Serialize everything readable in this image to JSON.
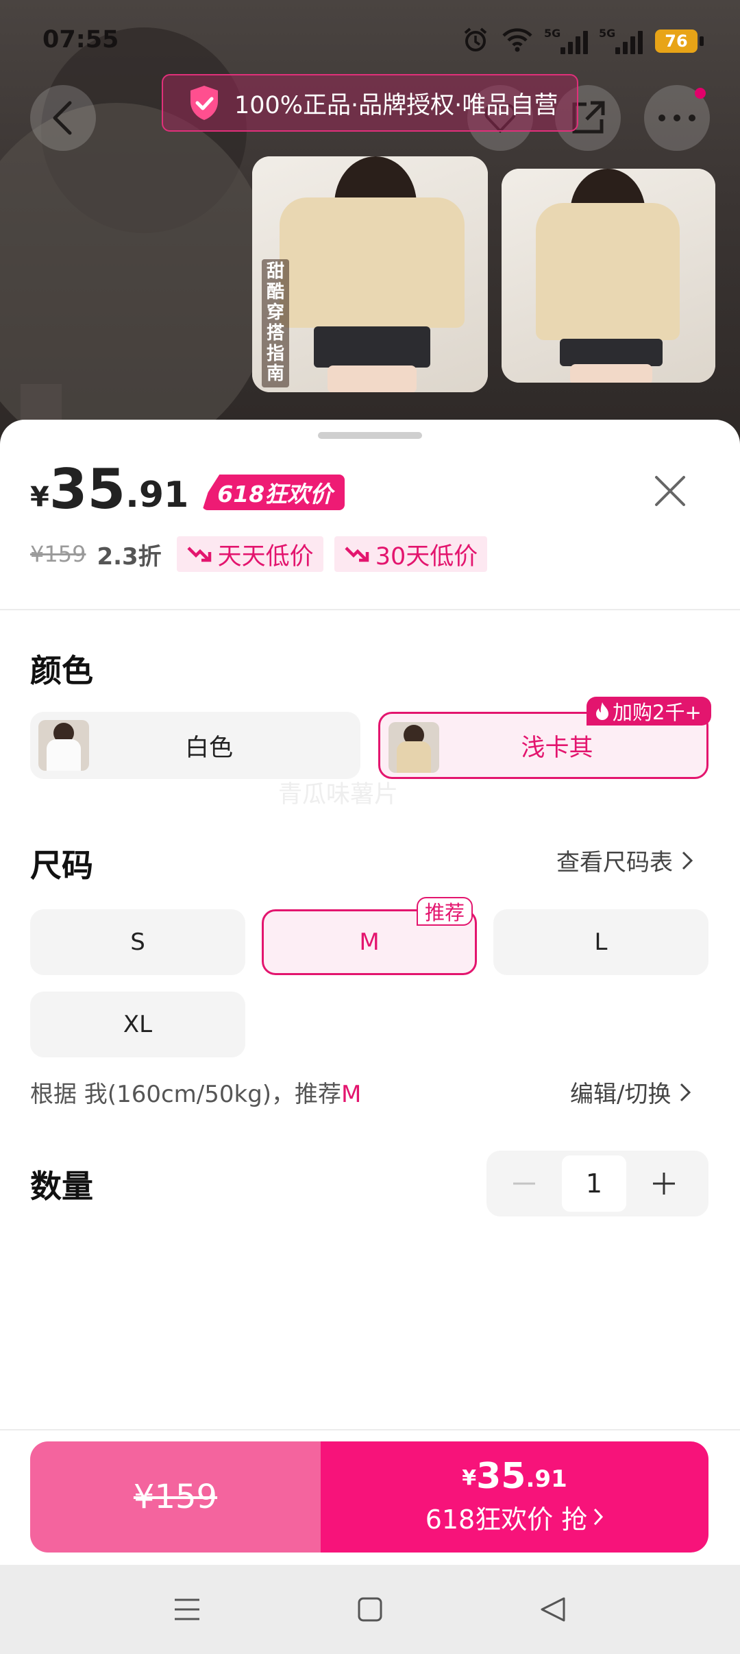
{
  "status_bar": {
    "time": "07:55",
    "signal1_label": "5G",
    "signal2_label": "5G",
    "battery": "76"
  },
  "top_nav": {
    "auth_banner": "100%正品·品牌授权·唯品自营"
  },
  "thumbnails": {
    "thumb1_overlay": "甜酷穿搭指南"
  },
  "product": {
    "price_currency": "¥",
    "price_integer": "35",
    "price_decimal": ".91",
    "promo_badge": "618狂欢价",
    "original_price": "¥159",
    "discount": "2.3折",
    "tag_daily_low": "天天低价",
    "tag_30day_low": "30天低价"
  },
  "color": {
    "title": "颜色",
    "options": [
      "白色",
      "浅卡其"
    ],
    "selected": "浅卡其",
    "hot_badge": "加购2千+"
  },
  "watermark": "青瓜味薯片",
  "size": {
    "title": "尺码",
    "size_chart_link": "查看尺码表",
    "options": [
      "S",
      "M",
      "L",
      "XL"
    ],
    "selected": "M",
    "recommend_badge": "推荐",
    "recommend_text": "根据 我(160cm/50kg)，推荐",
    "recommend_size": "M",
    "edit_link": "编辑/切换"
  },
  "quantity": {
    "title": "数量",
    "value": "1"
  },
  "buy_bar": {
    "original_price": "¥159",
    "price_currency": "¥",
    "price_integer": "35",
    "price_decimal": ".91",
    "action_label": "618狂欢价 抢"
  },
  "colors": {
    "brand_pink": "#e3156e",
    "buy_left": "#f4649e",
    "buy_right": "#f7137a",
    "battery": "#e8a417"
  }
}
